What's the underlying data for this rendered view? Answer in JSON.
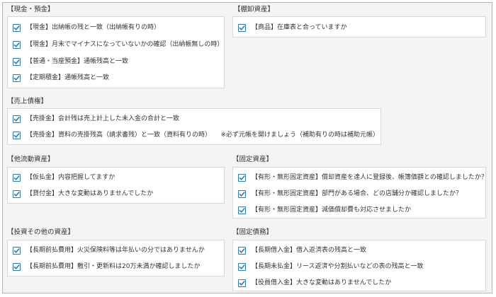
{
  "sections": {
    "genkin": {
      "title": "【現金・預金】",
      "items": [
        {
          "label": "【現金】出納帳の残と一致（出納帳有りの時）",
          "checked": true
        },
        {
          "label": "【現金】月末でマイナスになっていないかの確認（出納帳無しの時）",
          "checked": true
        },
        {
          "label": "【普通・当座預金】通帳残高と一致",
          "checked": true
        },
        {
          "label": "【定期積金】通帳残高と一致",
          "checked": true
        }
      ]
    },
    "tanaoroshi": {
      "title": "【棚卸資産】",
      "items": [
        {
          "label": "【商品】在庫表と合っていますか",
          "checked": true
        }
      ]
    },
    "uriage": {
      "title": "【売上債権】",
      "items": [
        {
          "label": "【売掛金】会計残は売上計上した未入金の合計と一致",
          "checked": true
        },
        {
          "label": "【売掛金】資料の売掛残高（請求書残）と一致（資料有りの時）　　※必ず元帳を開けましょう（補助有りの時は補助元帳）",
          "checked": true
        }
      ]
    },
    "tanagare": {
      "title": "【他流動資産】",
      "items": [
        {
          "label": "【仮払金】内容把握してますか",
          "checked": true
        },
        {
          "label": "【貸付金】大きな変動はありませんでしたか",
          "checked": true
        }
      ]
    },
    "kotei": {
      "title": "【固定資産】",
      "items": [
        {
          "label": "【有形・無形固定資産】償却資産を達人に登録後、帳簿価額との確認しましたか？",
          "checked": true
        },
        {
          "label": "【有形・無形固定資産】部門がある場合、どの店舗分か確認しましたか？",
          "checked": true
        },
        {
          "label": "【有形・無形固定資産】減価償却費も対応させましたか",
          "checked": true
        }
      ]
    },
    "toshi": {
      "title": "【投資その他の資産】",
      "items": [
        {
          "label": "【長期前払費用】火災保険料等は年払いの分ではありませんか",
          "checked": true
        },
        {
          "label": "【長期前払費用】敷引・更新料は20万未満か確認しましたか",
          "checked": true
        }
      ]
    },
    "kotei_fusai": {
      "title": "【固定債務】",
      "items": [
        {
          "label": "【長期借入金】借入返済表の残高と一致",
          "checked": true
        },
        {
          "label": "【長期未払金】リース返済や分割払いなどの表の残高と一致",
          "checked": true
        },
        {
          "label": "【役員借入金】大きな変動はありませんでしたか",
          "checked": true
        }
      ]
    }
  },
  "colors": {
    "checkbox_border": "#2a7ab8",
    "checkmark": "#2a7ab8",
    "panel_background": "#f4f4f4",
    "box_background": "#ffffff"
  }
}
